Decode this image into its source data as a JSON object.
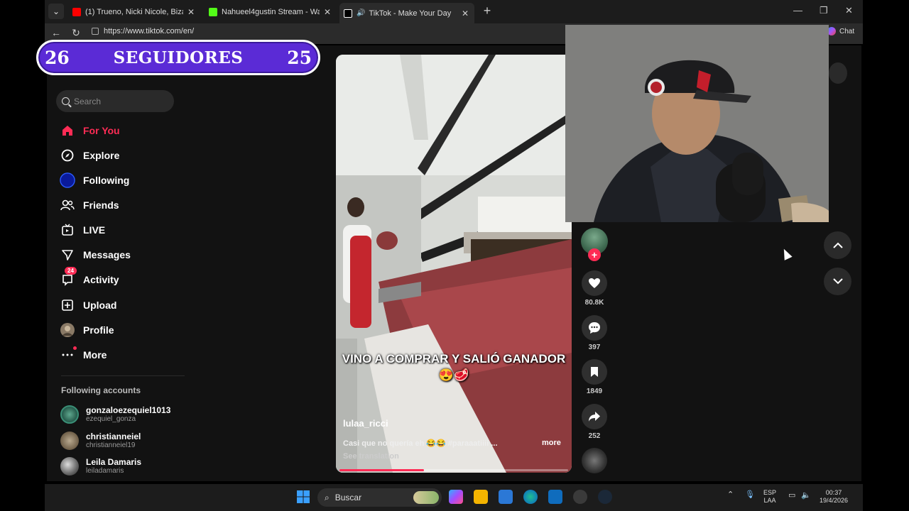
{
  "browser": {
    "tabs": [
      {
        "title": "(1) Trueno, Nicki Nicole, Bizarrap -",
        "favicon_color": "#ff0000"
      },
      {
        "title": "Nahueel4gustin Stream - Watch Li",
        "favicon_color": "#53fc18"
      },
      {
        "title": "TikTok - Make Your Day",
        "favicon_color": "#ffffff"
      }
    ],
    "url": "https://www.tiktok.com/en/",
    "chat_label": "Chat"
  },
  "overlay": {
    "left_count": "26",
    "label": "SEGUIDORES",
    "right_count": "25"
  },
  "sidebar": {
    "search_placeholder": "Search",
    "items": [
      {
        "label": "For You",
        "icon": "home-icon"
      },
      {
        "label": "Explore",
        "icon": "compass-icon"
      },
      {
        "label": "Following",
        "icon": "following-icon"
      },
      {
        "label": "Friends",
        "icon": "friends-icon"
      },
      {
        "label": "LIVE",
        "icon": "live-icon"
      },
      {
        "label": "Messages",
        "icon": "messages-icon"
      },
      {
        "label": "Activity",
        "icon": "activity-icon",
        "badge": "24"
      },
      {
        "label": "Upload",
        "icon": "upload-icon"
      },
      {
        "label": "Profile",
        "icon": "profile-icon"
      },
      {
        "label": "More",
        "icon": "more-icon"
      }
    ],
    "following_header": "Following accounts",
    "accounts": [
      {
        "name": "gonzaloezequiel1013",
        "handle": "ezequiel_gonza"
      },
      {
        "name": "christianneiel",
        "handle": "christianneiel19"
      },
      {
        "name": "Leila Damaris",
        "handle": "leiladamaris"
      }
    ]
  },
  "video": {
    "caption": "VINO A COMPRAR Y SALIÓ GANADOR😍🥩",
    "username": "lulaa_ricci",
    "description": "Casi que no quería eh 😂😂 #paraaatiiii ...",
    "more_label": "more",
    "translation_label": "See translation",
    "progress": 0.37
  },
  "actions": {
    "likes": "80.8K",
    "comments": "397",
    "saves": "1849",
    "shares": "252"
  },
  "taskbar": {
    "search_placeholder": "Buscar",
    "lang_top": "ESP",
    "lang_bottom": "LAA",
    "time": "00:37",
    "date": "19/4/2026"
  }
}
